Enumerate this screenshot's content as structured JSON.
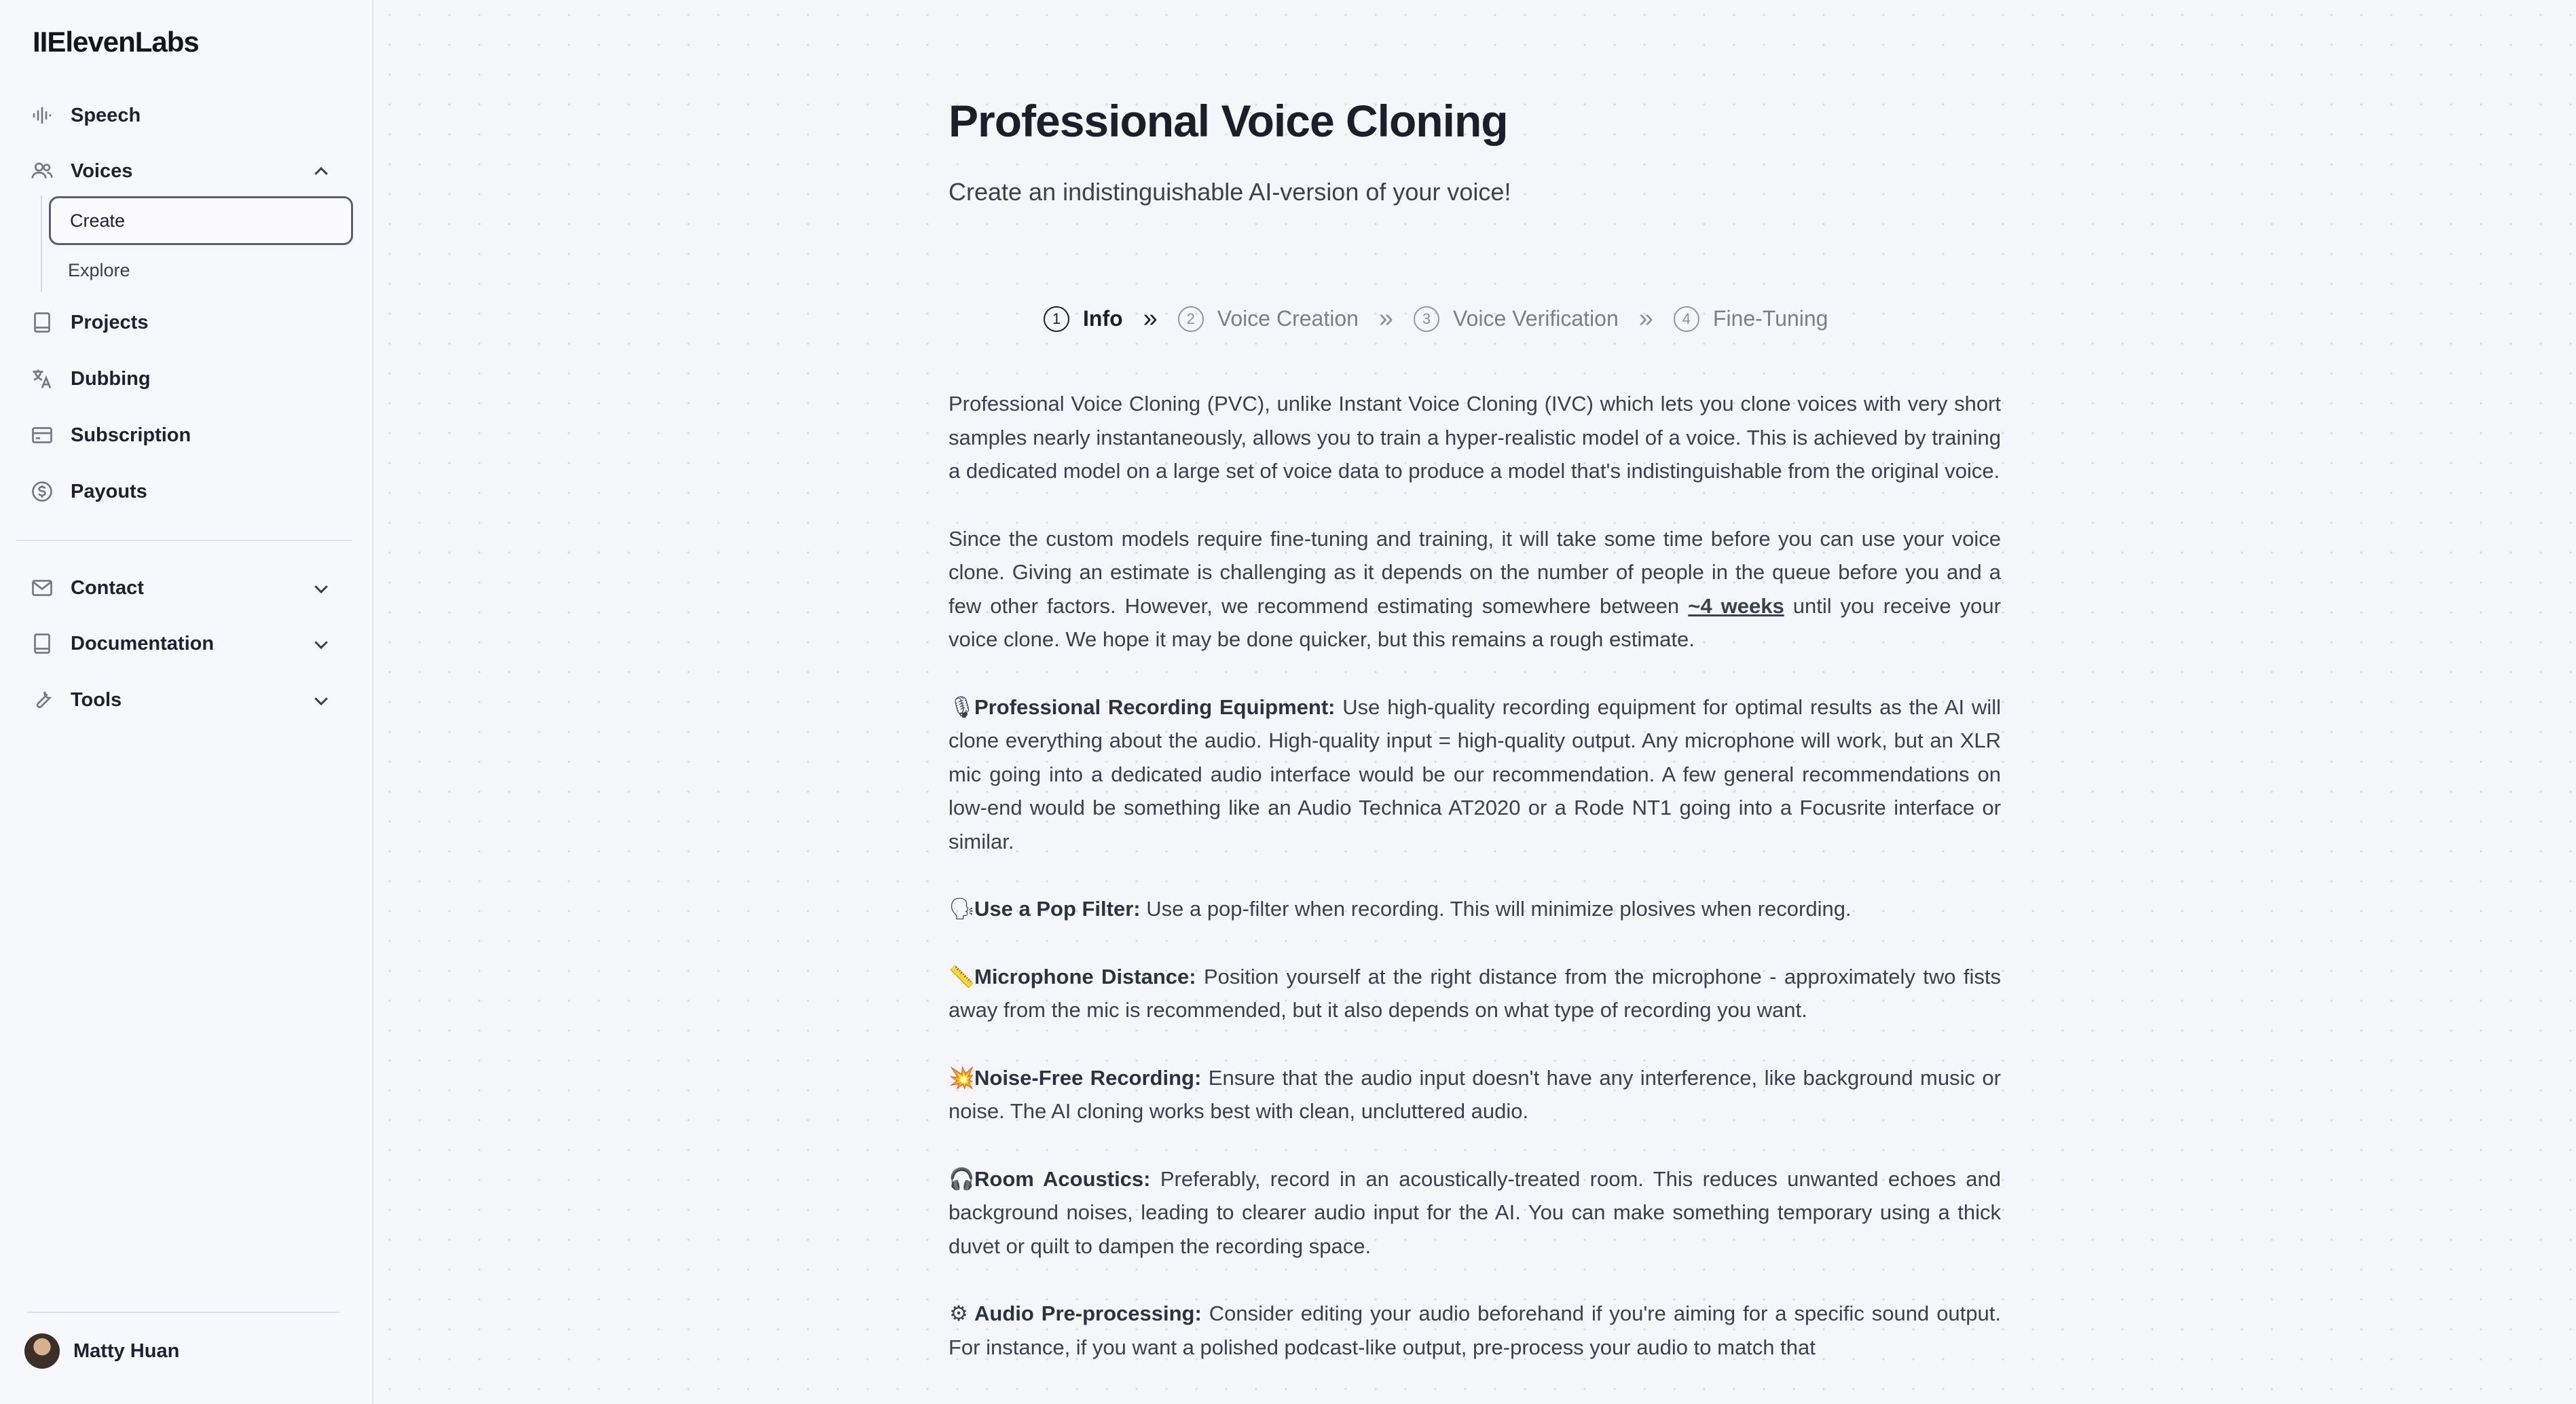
{
  "brand": "IIElevenLabs",
  "nav": {
    "speech": "Speech",
    "voices": "Voices",
    "voices_sub": {
      "create": "Create",
      "explore": "Explore"
    },
    "projects": "Projects",
    "dubbing": "Dubbing",
    "subscription": "Subscription",
    "payouts": "Payouts",
    "contact": "Contact",
    "documentation": "Documentation",
    "tools": "Tools"
  },
  "user": {
    "name": "Matty Huan"
  },
  "page": {
    "title": "Professional Voice Cloning",
    "subtitle": "Create an indistinguishable AI-version of your voice!"
  },
  "steps": [
    {
      "num": "1",
      "label": "Info"
    },
    {
      "num": "2",
      "label": "Voice Creation"
    },
    {
      "num": "3",
      "label": "Voice Verification"
    },
    {
      "num": "4",
      "label": "Fine-Tuning"
    }
  ],
  "content": {
    "intro": "Professional Voice Cloning (PVC), unlike Instant Voice Cloning (IVC) which lets you clone voices with very short samples nearly instantaneously, allows you to train a hyper-realistic model of a voice. This is achieved by training a dedicated model on a large set of voice data to produce a model that's indistinguishable from the original voice.",
    "timing_before": "Since the custom models require fine-tuning and training, it will take some time before you can use your voice clone. Giving an estimate is challenging as it depends on the number of people in the queue before you and a few other factors. However, we recommend estimating somewhere between ",
    "timing_link": "~4 weeks",
    "timing_after": " until you receive your voice clone. We hope it may be done quicker, but this remains a rough estimate.",
    "tips": [
      {
        "icon": "🎙",
        "title": "Professional Recording Equipment:",
        "text": " Use high-quality recording equipment for optimal results as the AI will clone everything about the audio. High-quality input = high-quality output. Any microphone will work, but an XLR mic going into a dedicated audio interface would be our recommendation. A few general recommendations on low-end would be something like an Audio Technica AT2020 or a Rode NT1 going into a Focusrite interface or similar."
      },
      {
        "icon": "🗣",
        "title": "Use a Pop Filter:",
        "text": " Use a pop-filter when recording. This will minimize plosives when recording."
      },
      {
        "icon": "📏",
        "title": "Microphone Distance:",
        "text": " Position yourself at the right distance from the microphone - approximately two fists away from the mic is recommended, but it also depends on what type of recording you want."
      },
      {
        "icon": "💥",
        "title": "Noise-Free Recording:",
        "text": " Ensure that the audio input doesn't have any interference, like background music or noise. The AI cloning works best with clean, uncluttered audio."
      },
      {
        "icon": "🎧",
        "title": "Room Acoustics:",
        "text": " Preferably, record in an acoustically-treated room. This reduces unwanted echoes and background noises, leading to clearer audio input for the AI. You can make something temporary using a thick duvet or quilt to dampen the recording space."
      },
      {
        "icon": "⚙",
        "title": "Audio Pre-processing:",
        "text": " Consider editing your audio beforehand if you're aiming for a specific sound output. For instance, if you want a polished podcast-like output, pre-process your audio to match that"
      }
    ]
  }
}
